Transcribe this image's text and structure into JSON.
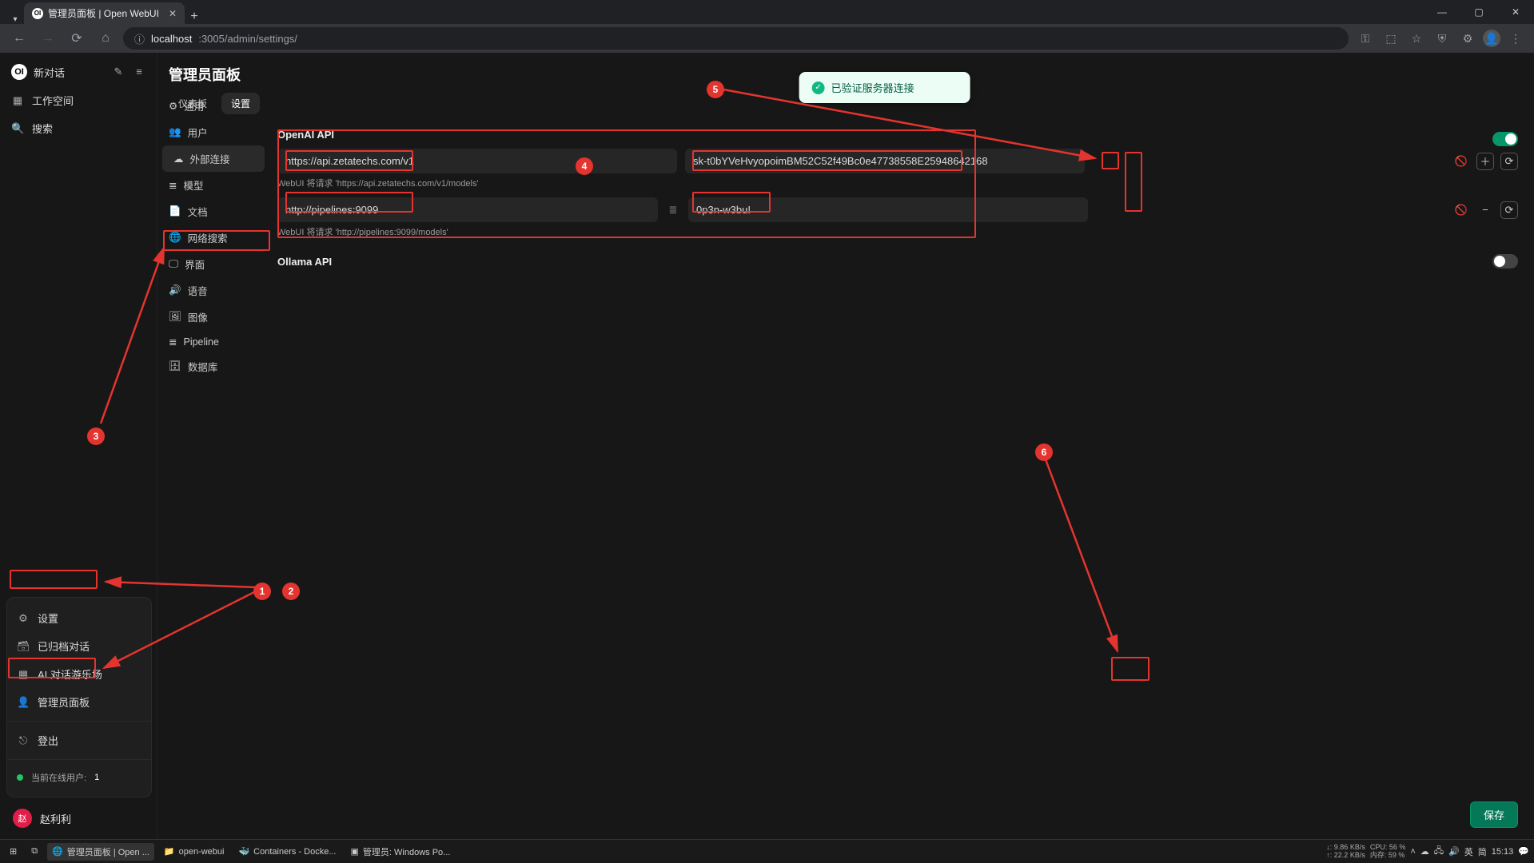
{
  "browser": {
    "tab_title": "管理员面板 | Open WebUI",
    "url_host": "localhost",
    "url_path": ":3005/admin/settings/"
  },
  "sidebar": {
    "logo_text": "OI",
    "new_chat": "新对话",
    "workspace": "工作空间",
    "search": "搜索"
  },
  "user_menu": {
    "settings": "设置",
    "archived": "已归档对话",
    "playground": "AI 对话游乐场",
    "admin_panel": "管理员面板",
    "logout": "登出",
    "online_label": "当前在线用户:",
    "online_count": "1",
    "user_name": "赵利利",
    "avatar_letter": "赵"
  },
  "page": {
    "title": "管理员面板",
    "tab_dashboard": "仪表板",
    "tab_settings": "设置"
  },
  "settings_nav": {
    "general": "通用",
    "users": "用户",
    "external": "外部连接",
    "models": "模型",
    "docs": "文档",
    "websearch": "网络搜索",
    "interface": "界面",
    "voice": "语音",
    "images": "图像",
    "pipeline": "Pipeline",
    "database": "数据库"
  },
  "openai": {
    "title": "OpenAI API",
    "rows": [
      {
        "url": "https://api.zetatechs.com/v1",
        "key": "sk-t0bYVeHvyopoimBM52C52f49Bc0e47738558E25948642168",
        "hint": "WebUI 将请求 'https://api.zetatechs.com/v1/models'"
      },
      {
        "url": "http://pipelines:9099",
        "key": "0p3n-w3bu!",
        "hint": "WebUI 将请求 'http://pipelines:9099/models'"
      }
    ]
  },
  "ollama": {
    "title": "Ollama API"
  },
  "toast": "已验证服务器连接",
  "save": "保存",
  "taskbar": {
    "items": [
      "管理员面板 | Open ...",
      "open-webui",
      "Containers - Docke...",
      "管理员: Windows Po..."
    ],
    "net_down": "↓: 9.86 KB/s",
    "net_up": "↑: 22.2 KB/s",
    "cpu": "CPU: 56 %",
    "mem": "内存: 59 %",
    "ime1": "英",
    "ime2": "简",
    "time": "15:13"
  }
}
